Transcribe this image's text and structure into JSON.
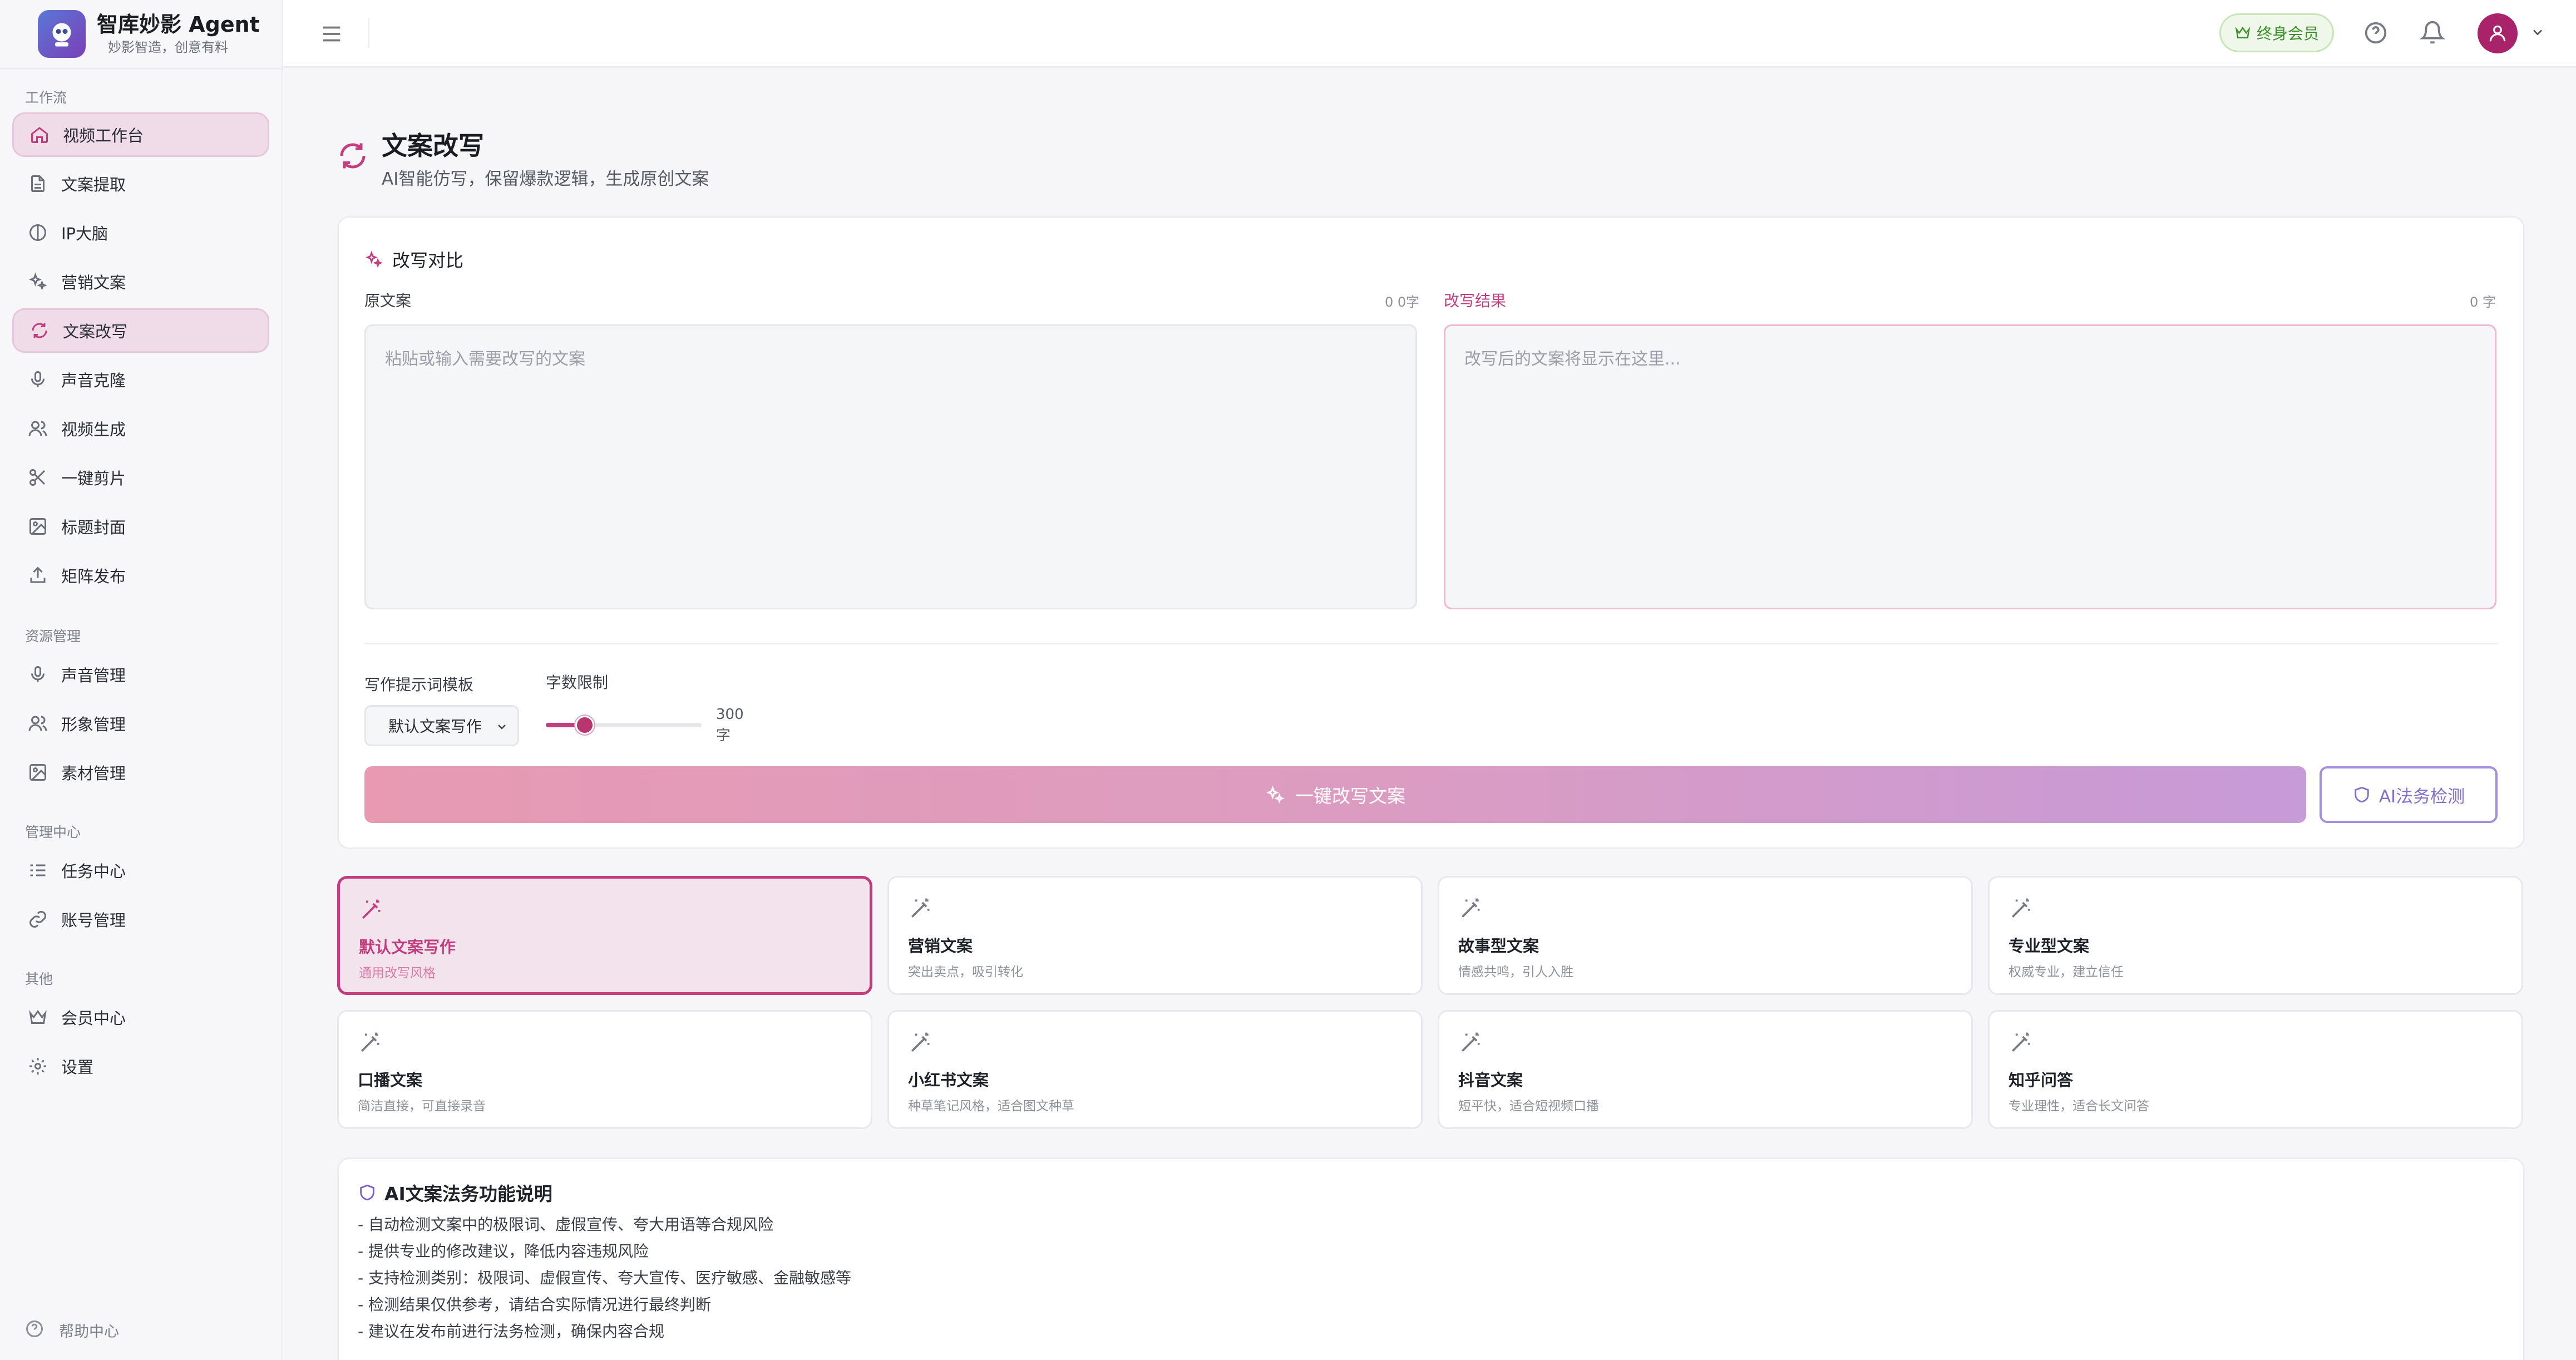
{
  "brand": {
    "title": "智库妙影 Agent",
    "subtitle": "妙影智造，创意有料"
  },
  "sidebar": {
    "sections": [
      {
        "label": "工作流"
      },
      {
        "label": "资源管理"
      },
      {
        "label": "管理中心"
      },
      {
        "label": "其他"
      }
    ],
    "items": [
      {
        "label": "视频工作台",
        "icon": "home-icon"
      },
      {
        "label": "文案提取",
        "icon": "document-icon"
      },
      {
        "label": "IP大脑",
        "icon": "brain-icon"
      },
      {
        "label": "营销文案",
        "icon": "sparkles-icon"
      },
      {
        "label": "文案改写",
        "icon": "refresh-icon"
      },
      {
        "label": "声音克隆",
        "icon": "microphone-icon"
      },
      {
        "label": "视频生成",
        "icon": "users-icon"
      },
      {
        "label": "一键剪片",
        "icon": "scissors-icon"
      },
      {
        "label": "标题封面",
        "icon": "image-icon"
      },
      {
        "label": "矩阵发布",
        "icon": "upload-icon"
      },
      {
        "label": "声音管理",
        "icon": "microphone-icon"
      },
      {
        "label": "形象管理",
        "icon": "users-icon"
      },
      {
        "label": "素材管理",
        "icon": "image-icon"
      },
      {
        "label": "任务中心",
        "icon": "list-icon"
      },
      {
        "label": "账号管理",
        "icon": "link-icon"
      },
      {
        "label": "会员中心",
        "icon": "crown-icon"
      },
      {
        "label": "设置",
        "icon": "gear-icon"
      }
    ],
    "help": "帮助中心"
  },
  "header": {
    "member_badge": "终身会员"
  },
  "page": {
    "title": "文案改写",
    "subtitle": "AI智能仿写，保留爆款逻辑，生成原创文案"
  },
  "compare": {
    "heading": "改写对比",
    "original_label": "原文案",
    "original_count": "0 0字",
    "original_placeholder": "粘贴或输入需要改写的文案",
    "result_label": "改写结果",
    "result_count": "0 字",
    "result_placeholder": "改写后的文案将显示在这里...",
    "template_label": "写作提示词模板",
    "template_value": "默认文案写作",
    "limit_label": "字数限制",
    "limit_value": "300",
    "limit_unit": "字",
    "limit_fraction": 0.25,
    "rewrite_button": "一键改写文案",
    "legal_button": "AI法务检测"
  },
  "templates": [
    {
      "name": "默认文案写作",
      "desc": "通用改写风格"
    },
    {
      "name": "营销文案",
      "desc": "突出卖点，吸引转化"
    },
    {
      "name": "故事型文案",
      "desc": "情感共鸣，引人入胜"
    },
    {
      "name": "专业型文案",
      "desc": "权威专业，建立信任"
    },
    {
      "name": "口播文案",
      "desc": "简洁直接，可直接录音"
    },
    {
      "name": "小红书文案",
      "desc": "种草笔记风格，适合图文种草"
    },
    {
      "name": "抖音文案",
      "desc": "短平快，适合短视频口播"
    },
    {
      "name": "知乎问答",
      "desc": "专业理性，适合长文问答"
    }
  ],
  "legal_info": {
    "heading": "AI文案法务功能说明",
    "lines": [
      "- 自动检测文案中的极限词、虚假宣传、夸大用语等合规风险",
      "- 提供专业的修改建议，降低内容违规风险",
      "- 支持检测类别：极限词、虚假宣传、夸大宣传、医疗敏感、金融敏感等",
      "- 检测结果仅供参考，请结合实际情况进行最终判断",
      "- 建议在发布前进行法务检测，确保内容合规"
    ]
  },
  "colors": {
    "accent": "#c23d7d",
    "legal": "#8570c8",
    "member": "#3d8f2a"
  }
}
